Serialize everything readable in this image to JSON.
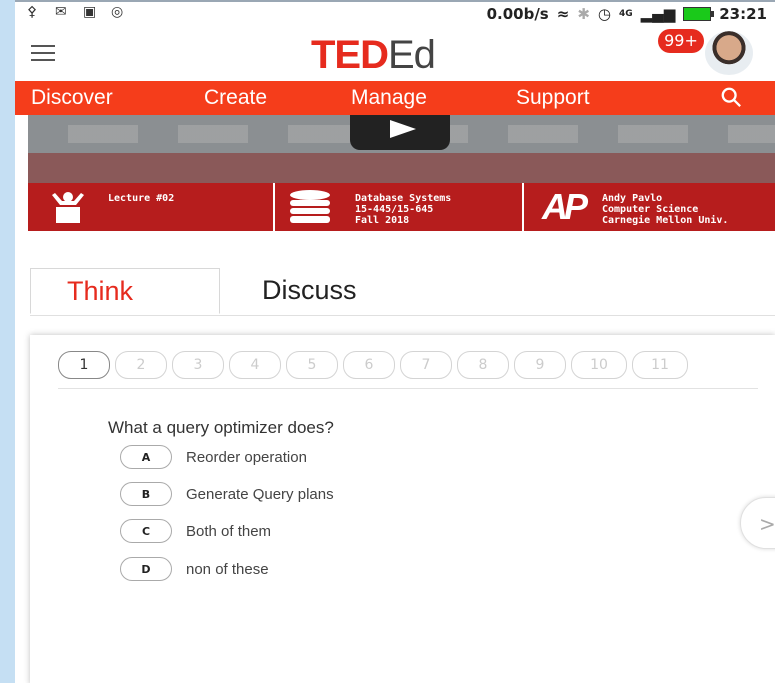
{
  "status_bar": {
    "speed": "0.00b/s",
    "time": "23:21",
    "network": "4G",
    "left_icons": [
      "user-icon",
      "mail-icon",
      "image-icon",
      "alarm-icon"
    ]
  },
  "header": {
    "logo_ted": "TED",
    "logo_ed": "Ed",
    "notification_count": "99+"
  },
  "nav": {
    "items": [
      "Discover",
      "Create",
      "Manage",
      "Support"
    ]
  },
  "video": {
    "lecture": "Lecture #02",
    "course_line1": "Database Systems",
    "course_line2": "15-445/15-645",
    "course_line3": "Fall 2018",
    "logo_text": "AP",
    "instructor_line1": "Andy Pavlo",
    "instructor_line2": "Computer Science",
    "instructor_line3": "Carnegie Mellon Univ."
  },
  "tabs": {
    "think": "Think",
    "discuss": "Discuss"
  },
  "question": {
    "numbers": [
      "1",
      "2",
      "3",
      "4",
      "5",
      "6",
      "7",
      "8",
      "9",
      "10",
      "11"
    ],
    "active_index": 0,
    "text": "What a query optimizer does?",
    "options": [
      {
        "letter": "A",
        "text": "Reorder operation"
      },
      {
        "letter": "B",
        "text": "Generate Query plans"
      },
      {
        "letter": "C",
        "text": "Both of them"
      },
      {
        "letter": "D",
        "text": "non of these"
      }
    ],
    "next_label": ">"
  },
  "colors": {
    "brand_red": "#e62b1e",
    "nav_red": "#f53d1b",
    "info_red": "#b61d1d"
  }
}
